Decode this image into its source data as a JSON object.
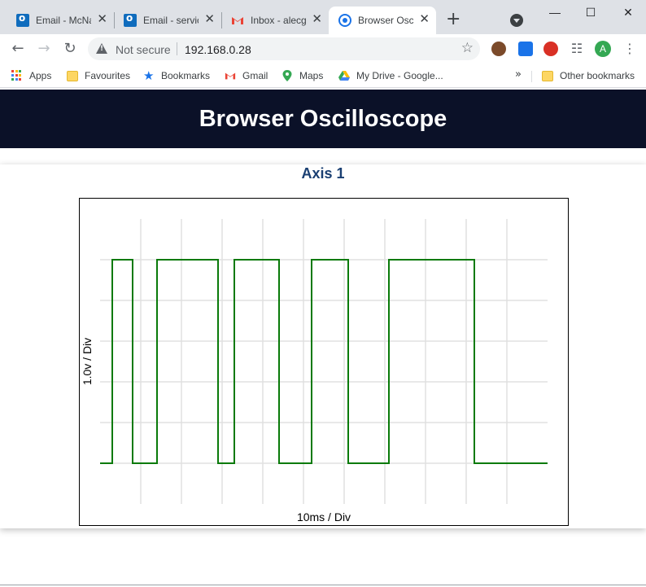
{
  "browser": {
    "tabs": [
      {
        "title": "Email - McNa",
        "icon": "outlook-icon",
        "active": false
      },
      {
        "title": "Email - servic",
        "icon": "outlook-icon",
        "active": false
      },
      {
        "title": "Inbox - alecg",
        "icon": "gmail-icon",
        "active": false
      },
      {
        "title": "Browser Osc",
        "icon": "globe-icon",
        "active": true
      }
    ],
    "address": {
      "security_label": "Not secure",
      "url": "192.168.0.28"
    },
    "bookmarks": [
      {
        "label": "Apps",
        "icon": "apps-grid-icon"
      },
      {
        "label": "Favourites",
        "icon": "folder-icon"
      },
      {
        "label": "Bookmarks",
        "icon": "star-icon"
      },
      {
        "label": "Gmail",
        "icon": "gmail-icon"
      },
      {
        "label": "Maps",
        "icon": "maps-pin-icon"
      },
      {
        "label": "My Drive - Google...",
        "icon": "drive-icon"
      }
    ],
    "other_bookmarks": "Other bookmarks",
    "profile_initial": "A"
  },
  "page": {
    "title": "Browser Oscilloscope"
  },
  "chart_data": {
    "type": "line",
    "title": "Axis 1",
    "xlabel": "10ms / Div",
    "ylabel": "1.0v / Div",
    "xlim": [
      0,
      11
    ],
    "ylim": [
      0,
      7
    ],
    "grid": true,
    "line_color": "#0a7a0a",
    "series": [
      {
        "x": [
          0,
          0.3,
          0.3,
          0.8,
          0.8,
          1.4,
          1.4,
          2.9,
          2.9,
          3.3,
          3.3,
          4.4,
          4.4,
          5.2,
          5.2,
          6.1,
          6.1,
          7.1,
          7.1,
          9.2,
          9.2,
          11
        ],
        "values": [
          1,
          1,
          6,
          6,
          1,
          1,
          6,
          6,
          1,
          1,
          6,
          6,
          1,
          1,
          6,
          6,
          1,
          1,
          6,
          6,
          1,
          1
        ]
      }
    ]
  }
}
